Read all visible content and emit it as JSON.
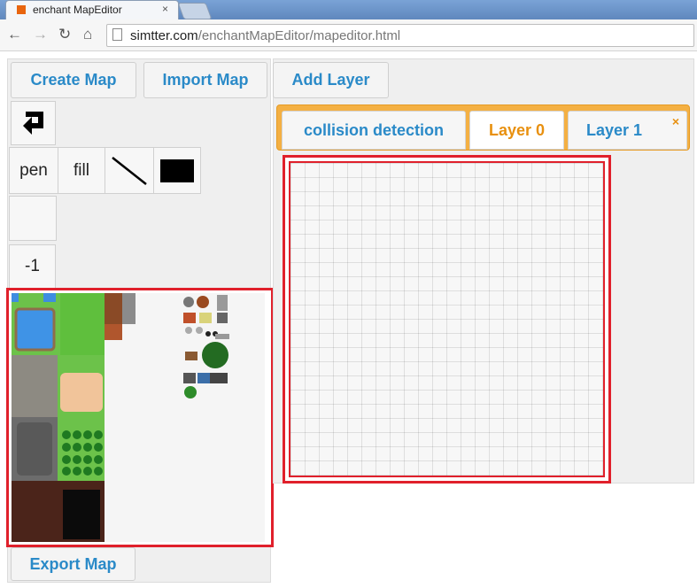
{
  "browser": {
    "tab_title": "enchant MapEditor",
    "tab_close": "×",
    "url_host": "simtter.com",
    "url_path": "/enchantMapEditor/mapeditor.html"
  },
  "toolbar": {
    "back_icon": "←",
    "forward_icon": "→",
    "reload_icon": "↻",
    "home_icon": "⌂"
  },
  "left": {
    "create_map": "Create Map",
    "import_map": "Import Map",
    "tools": {
      "pen": "pen",
      "fill": "fill"
    },
    "layer_value": "-1",
    "export_map": "Export Map"
  },
  "right": {
    "add_layer": "Add Layer",
    "tabs": [
      {
        "label": "collision detection"
      },
      {
        "label": "Layer 0"
      },
      {
        "label": "Layer 1"
      }
    ],
    "close_tab": "×"
  },
  "colors": {
    "accent_blue": "#2a8ac8",
    "accent_orange": "#f4b043",
    "highlight_red": "#e0202b"
  }
}
